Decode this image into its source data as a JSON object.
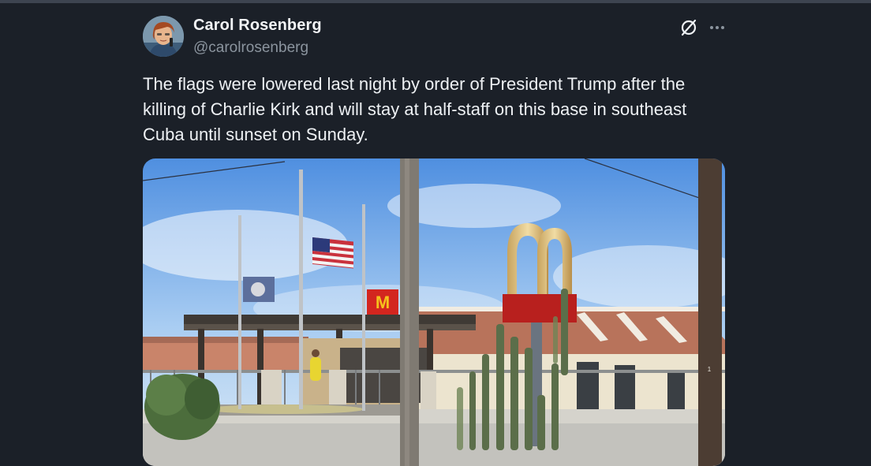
{
  "tweet": {
    "author": {
      "display_name": "Carol Rosenberg",
      "handle": "@carolrosenberg"
    },
    "text_lines": [
      "The flags were lowered last night by order of President Trump after the",
      "killing of Charlie Kirk and will stay at half-staff on this base in southeast",
      "Cuba until sunset on Sunday."
    ],
    "icons": {
      "grok": "grok-icon",
      "more": "more-icon",
      "avatar": "avatar"
    }
  },
  "colors": {
    "background": "#1b2028",
    "text": "#eef1f4",
    "secondary_text": "#8b949e"
  }
}
